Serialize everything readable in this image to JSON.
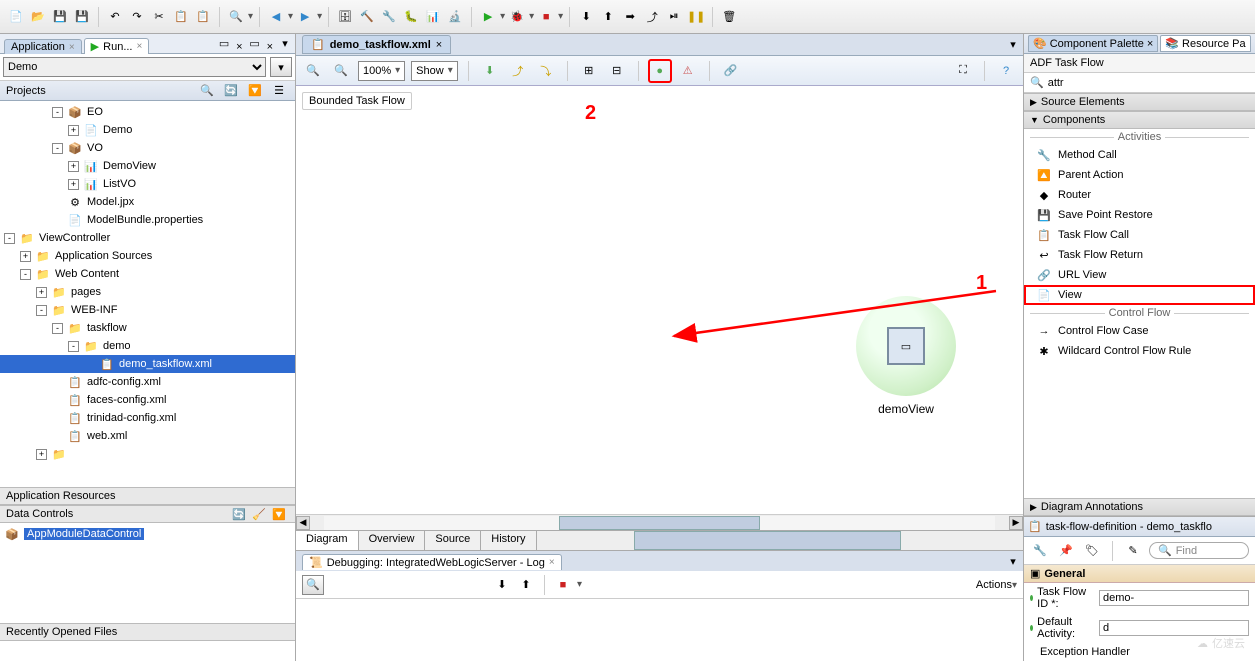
{
  "toolbar": {},
  "left": {
    "app_tabs": [
      {
        "label": "Application",
        "closable": true
      },
      {
        "label": "Run...",
        "closable": true
      }
    ],
    "app_combo": "Demo",
    "projects_title": "Projects",
    "tree": [
      {
        "indent": 3,
        "exp": "-",
        "icon": "📦",
        "label": "EO"
      },
      {
        "indent": 4,
        "exp": "+",
        "icon": "📄",
        "label": "Demo"
      },
      {
        "indent": 3,
        "exp": "-",
        "icon": "📦",
        "label": "VO"
      },
      {
        "indent": 4,
        "exp": "+",
        "icon": "📊",
        "label": "DemoView"
      },
      {
        "indent": 4,
        "exp": "+",
        "icon": "📊",
        "label": "ListVO"
      },
      {
        "indent": 3,
        "exp": "",
        "icon": "⚙",
        "label": "Model.jpx"
      },
      {
        "indent": 3,
        "exp": "",
        "icon": "📄",
        "label": "ModelBundle.properties"
      },
      {
        "indent": 0,
        "exp": "-",
        "icon": "📁",
        "label": "ViewController"
      },
      {
        "indent": 1,
        "exp": "+",
        "icon": "📁",
        "label": "Application Sources"
      },
      {
        "indent": 1,
        "exp": "-",
        "icon": "📁",
        "label": "Web Content"
      },
      {
        "indent": 2,
        "exp": "+",
        "icon": "📁",
        "label": "pages"
      },
      {
        "indent": 2,
        "exp": "-",
        "icon": "📁",
        "label": "WEB-INF"
      },
      {
        "indent": 3,
        "exp": "-",
        "icon": "📁",
        "label": "taskflow"
      },
      {
        "indent": 4,
        "exp": "-",
        "icon": "📁",
        "label": "demo"
      },
      {
        "indent": 5,
        "exp": "",
        "icon": "📋",
        "label": "demo_taskflow.xml",
        "selected": true
      },
      {
        "indent": 3,
        "exp": "",
        "icon": "📋",
        "label": "adfc-config.xml"
      },
      {
        "indent": 3,
        "exp": "",
        "icon": "📋",
        "label": "faces-config.xml"
      },
      {
        "indent": 3,
        "exp": "",
        "icon": "📋",
        "label": "trinidad-config.xml"
      },
      {
        "indent": 3,
        "exp": "",
        "icon": "📋",
        "label": "web.xml"
      },
      {
        "indent": 2,
        "exp": "+",
        "icon": "📁",
        "label": ""
      }
    ],
    "app_resources": "Application Resources",
    "data_controls": "Data Controls",
    "data_control_item": "AppModuleDataControl",
    "recent_files": "Recently Opened Files"
  },
  "editor": {
    "tab_label": "demo_taskflow.xml",
    "zoom": "100%",
    "show_label": "Show",
    "bounded_label": "Bounded Task Flow",
    "node_label": "demoView",
    "bottom_tabs": [
      "Diagram",
      "Overview",
      "Source",
      "History"
    ]
  },
  "debug": {
    "tab_label": "Debugging: IntegratedWebLogicServer - Log",
    "actions_label": "Actions"
  },
  "palette": {
    "tabs": [
      "Component Palette",
      "Resource Pa"
    ],
    "title": "ADF Task Flow",
    "search": "attr",
    "sections": {
      "source_elements": "Source Elements",
      "components": "Components",
      "activities": "Activities",
      "activity_items": [
        {
          "icon": "🔧",
          "label": "Method Call"
        },
        {
          "icon": "🔼",
          "label": "Parent Action"
        },
        {
          "icon": "◆",
          "label": "Router"
        },
        {
          "icon": "💾",
          "label": "Save Point Restore"
        },
        {
          "icon": "📋",
          "label": "Task Flow Call"
        },
        {
          "icon": "↩",
          "label": "Task Flow Return"
        },
        {
          "icon": "🔗",
          "label": "URL View"
        },
        {
          "icon": "📄",
          "label": "View",
          "highlight": true
        }
      ],
      "control_flow": "Control Flow",
      "cf_items": [
        {
          "icon": "→",
          "label": "Control Flow Case"
        },
        {
          "icon": "✱",
          "label": "Wildcard Control Flow Rule"
        }
      ],
      "diagram_annotations": "Diagram Annotations"
    }
  },
  "props": {
    "title": "task-flow-definition - demo_taskflo",
    "find": "Find",
    "group": "General",
    "rows": [
      {
        "label": "Task Flow ID *:",
        "value": "demo-"
      },
      {
        "label": "Default Activity:",
        "value": "d"
      }
    ],
    "exception_handler": "Exception Handler"
  },
  "annotations": {
    "num1": "1",
    "num2": "2"
  },
  "watermark": "亿速云"
}
